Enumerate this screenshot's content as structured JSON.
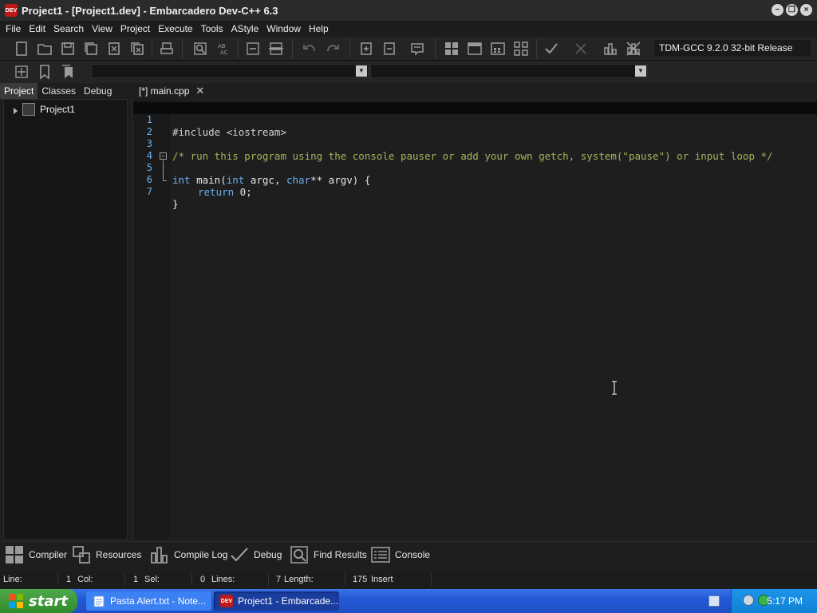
{
  "window": {
    "title": "Project1 - [Project1.dev] - Embarcadero Dev-C++ 6.3",
    "icon_text": "DEV"
  },
  "menu": [
    "File",
    "Edit",
    "Search",
    "View",
    "Project",
    "Execute",
    "Tools",
    "AStyle",
    "Window",
    "Help"
  ],
  "toolbar": {
    "compiler": "TDM-GCC 9.2.0 32-bit Release"
  },
  "left_panel": {
    "tabs": [
      "Project",
      "Classes",
      "Debug"
    ],
    "active_tab": "Project",
    "tree": [
      {
        "label": "Project1"
      }
    ]
  },
  "editor": {
    "tab_label": "[*] main.cpp",
    "lines": [
      {
        "n": "1",
        "pre": "#include <iostream>"
      },
      {
        "n": "2"
      },
      {
        "n": "3",
        "comment": "/* run this program using the console pauser or add your own getch, system(\"pause\") or input loop */"
      },
      {
        "n": "4"
      },
      {
        "n": "5",
        "kw1": "int",
        "t1": " main(",
        "kw2": "int",
        "t2": " argc, ",
        "kw3": "char",
        "t3": "** argv) {"
      },
      {
        "n": "6",
        "kw1": "return",
        "t1": " 0;"
      },
      {
        "n": "7",
        "t1": "}"
      }
    ]
  },
  "bottom_tabs": [
    "Compiler",
    "Resources",
    "Compile Log",
    "Debug",
    "Find Results",
    "Console"
  ],
  "status": {
    "line_label": "Line:",
    "line_value": "1",
    "col_label": "Col:",
    "col_value": "1",
    "sel_label": "Sel:",
    "sel_value": "0",
    "lines_label": "Lines:",
    "lines_value": "7",
    "length_label": "Length:",
    "length_value": "175",
    "mode": "Insert"
  },
  "taskbar": {
    "start_label": "start",
    "items": [
      "Pasta Alert.txt - Note...",
      "Project1 - Embarcade..."
    ],
    "clock": "5:17 PM"
  },
  "colors": {
    "keyword": "#6ab0f0",
    "comment": "#a7b35a",
    "line_number": "#6ab0f0"
  }
}
